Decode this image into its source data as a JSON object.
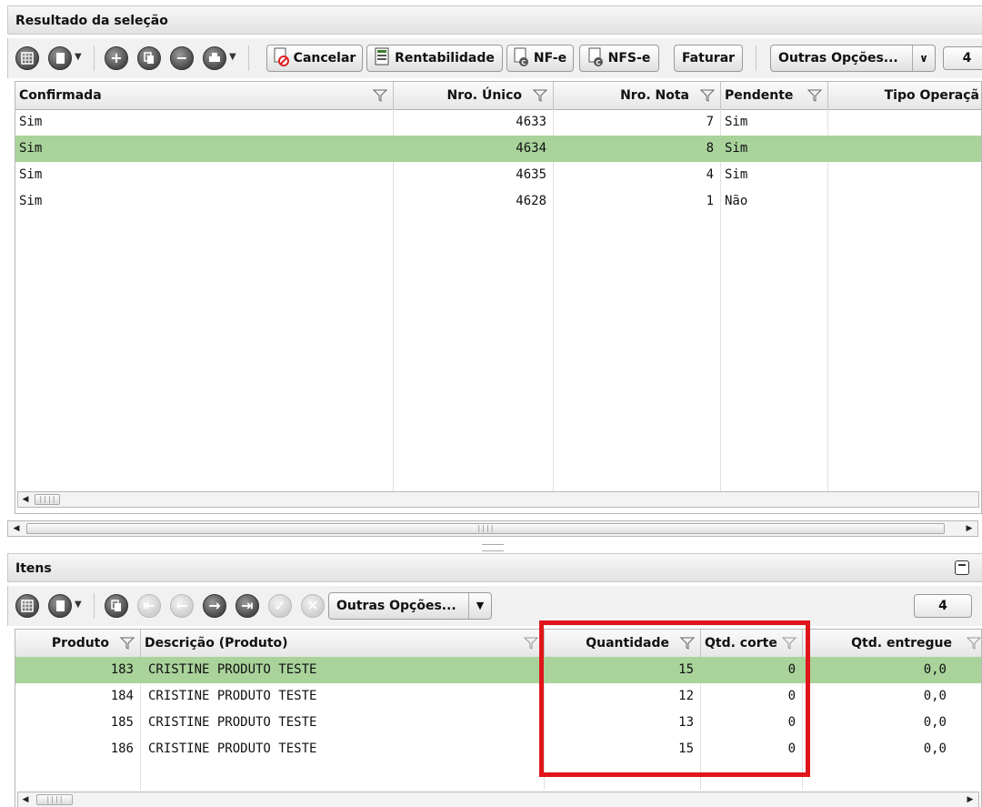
{
  "top": {
    "title": "Resultado da seleção",
    "buttons": {
      "cancelar": "Cancelar",
      "rentabilidade": "Rentabilidade",
      "nfe": "NF-e",
      "nfse": "NFS-e",
      "faturar": "Faturar",
      "outras": "Outras Opções...",
      "count": "4"
    },
    "columns": [
      "Confirmada",
      "Nro. Único",
      "Nro. Nota",
      "Pendente",
      "Tipo Operaçã"
    ],
    "rows": [
      {
        "confirmada": "Sim",
        "nro_unico": "4633",
        "nro_nota": "7",
        "pendente": "Sim",
        "selected": false
      },
      {
        "confirmada": "Sim",
        "nro_unico": "4634",
        "nro_nota": "8",
        "pendente": "Sim",
        "selected": true
      },
      {
        "confirmada": "Sim",
        "nro_unico": "4635",
        "nro_nota": "4",
        "pendente": "Sim",
        "selected": false
      },
      {
        "confirmada": "Sim",
        "nro_unico": "4628",
        "nro_nota": "1",
        "pendente": "Não",
        "selected": false
      }
    ]
  },
  "items": {
    "title": "Itens",
    "outras": "Outras Opções...",
    "count": "4",
    "columns": [
      "Produto",
      "Descrição (Produto)",
      "Quantidade",
      "Qtd. corte",
      "Qtd. entregue"
    ],
    "rows": [
      {
        "produto": "183",
        "descricao": "CRISTINE PRODUTO TESTE",
        "quantidade": "15",
        "corte": "0",
        "entregue": "0,0",
        "selected": true
      },
      {
        "produto": "184",
        "descricao": "CRISTINE PRODUTO TESTE",
        "quantidade": "12",
        "corte": "0",
        "entregue": "0,0",
        "selected": false
      },
      {
        "produto": "185",
        "descricao": "CRISTINE PRODUTO TESTE",
        "quantidade": "13",
        "corte": "0",
        "entregue": "0,0",
        "selected": false
      },
      {
        "produto": "186",
        "descricao": "CRISTINE PRODUTO TESTE",
        "quantidade": "15",
        "corte": "0",
        "entregue": "0,0",
        "selected": false
      }
    ]
  },
  "colors": {
    "selected_row": "#a9d39b",
    "highlight_box": "#e0151b"
  }
}
